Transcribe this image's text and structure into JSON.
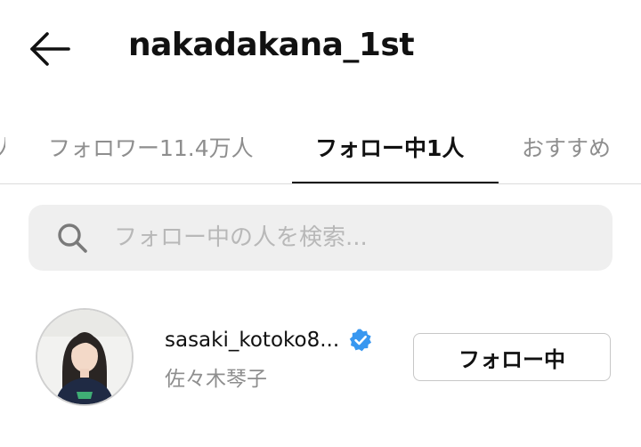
{
  "header": {
    "back_icon": "arrow-left-icon",
    "title": "nakadakana_1st"
  },
  "tabs": [
    {
      "label": "フォロワー11.4万人",
      "active": false
    },
    {
      "label": "フォロー中1人",
      "active": true
    },
    {
      "label": "おすすめ",
      "active": false
    }
  ],
  "search": {
    "icon": "search-icon",
    "placeholder": "フォロー中の人を検索...",
    "value": ""
  },
  "users": [
    {
      "username": "sasaki_kotoko8...",
      "display_name": "佐々木琴子",
      "verified": true,
      "verified_color": "#3897f0",
      "button_label": "フォロー中"
    }
  ]
}
